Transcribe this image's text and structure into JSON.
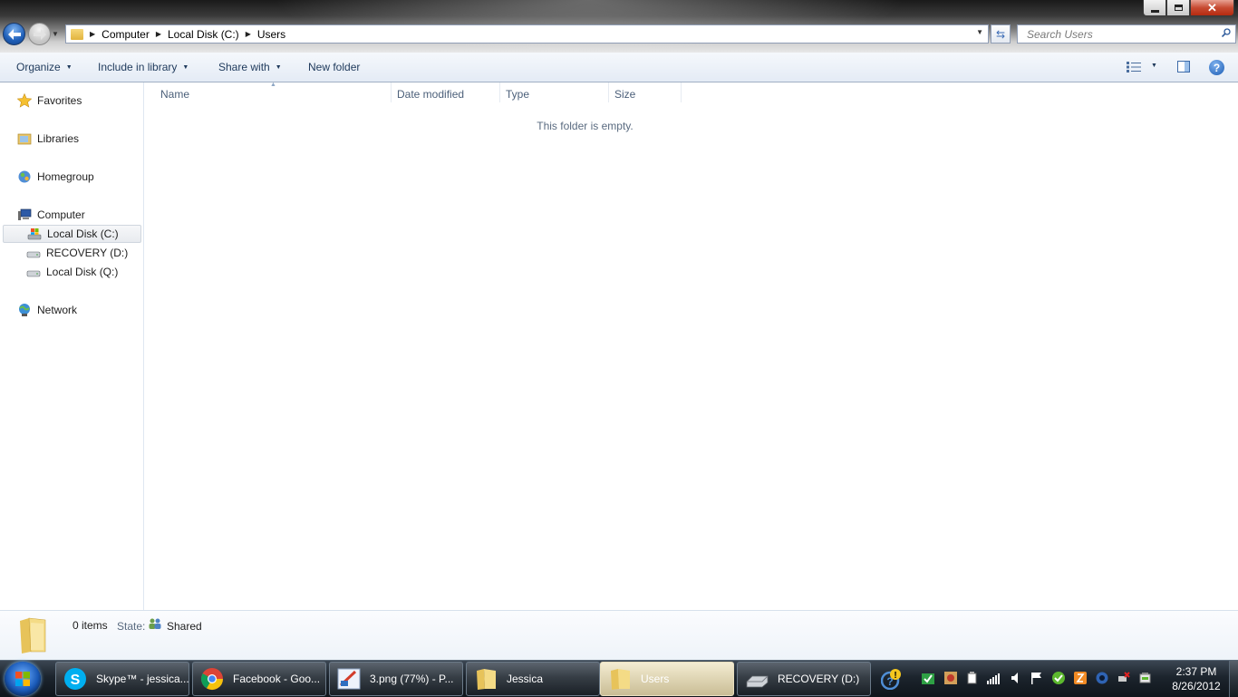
{
  "window": {
    "minimize_icon": "minimize-icon",
    "maximize_icon": "restore-icon",
    "close_glyph": "✕"
  },
  "address_bar": {
    "breadcrumbs": [
      "Computer",
      "Local Disk (C:)",
      "Users"
    ],
    "search_placeholder": "Search Users"
  },
  "command_bar": {
    "organize": "Organize",
    "include_in_library": "Include in library",
    "share_with": "Share with",
    "new_folder": "New folder"
  },
  "nav_pane": {
    "favorites": "Favorites",
    "libraries": "Libraries",
    "homegroup": "Homegroup",
    "computer": "Computer",
    "drives": [
      "Local Disk (C:)",
      "RECOVERY (D:)",
      "Local Disk (Q:)"
    ],
    "network": "Network",
    "selected": "Local Disk (C:)"
  },
  "content": {
    "columns": [
      "Name",
      "Date modified",
      "Type",
      "Size"
    ],
    "empty_message": "This folder is empty."
  },
  "details_pane": {
    "item_count": "0 items",
    "state_label": "State:",
    "state_value": "Shared"
  },
  "taskbar": {
    "buttons": [
      {
        "label": "Skype™ - jessica...",
        "icon": "skype-icon"
      },
      {
        "label": "Facebook - Goo...",
        "icon": "chrome-icon"
      },
      {
        "label": "3.png (77%) - P...",
        "icon": "paint-icon"
      },
      {
        "label": "Jessica",
        "icon": "folder-icon"
      },
      {
        "label": "Users",
        "icon": "folder-icon",
        "active": true
      },
      {
        "label": "RECOVERY (D:)",
        "icon": "drive-icon"
      }
    ],
    "clock_time": "2:37 PM",
    "clock_date": "8/26/2012"
  },
  "colors": {
    "accent": "#1e395b",
    "close_button": "#c74b32",
    "taskbar": "#1c242d"
  }
}
